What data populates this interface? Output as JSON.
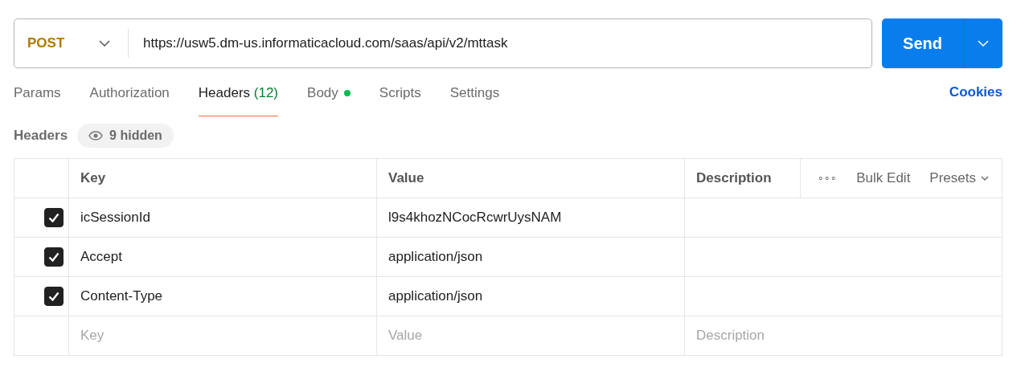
{
  "request": {
    "method": "POST",
    "url": "https://usw5.dm-us.informaticacloud.com/saas/api/v2/mttask",
    "send_label": "Send"
  },
  "tabs": [
    {
      "label": "Params",
      "selected": false
    },
    {
      "label": "Authorization",
      "selected": false
    },
    {
      "label": "Headers",
      "count": "(12)",
      "selected": true
    },
    {
      "label": "Body",
      "has_content": true,
      "selected": false
    },
    {
      "label": "Scripts",
      "selected": false
    },
    {
      "label": "Settings",
      "selected": false
    }
  ],
  "cookies_link": "Cookies",
  "headers_section": {
    "title": "Headers",
    "hidden_toggle": "9 hidden"
  },
  "table": {
    "columns": [
      "Key",
      "Value",
      "Description"
    ],
    "actions": {
      "more": "∘∘∘",
      "bulk_edit": "Bulk Edit",
      "presets": "Presets"
    },
    "rows": [
      {
        "checked": true,
        "key": "icSessionId",
        "value": "l9s4khozNCocRcwrUysNAM"
      },
      {
        "checked": true,
        "key": "Accept",
        "value": "application/json"
      },
      {
        "checked": true,
        "key": "Content-Type",
        "value": "application/json"
      }
    ],
    "new_row": {
      "key_placeholder": "Key",
      "value_placeholder": "Value",
      "description_placeholder": "Description"
    }
  }
}
